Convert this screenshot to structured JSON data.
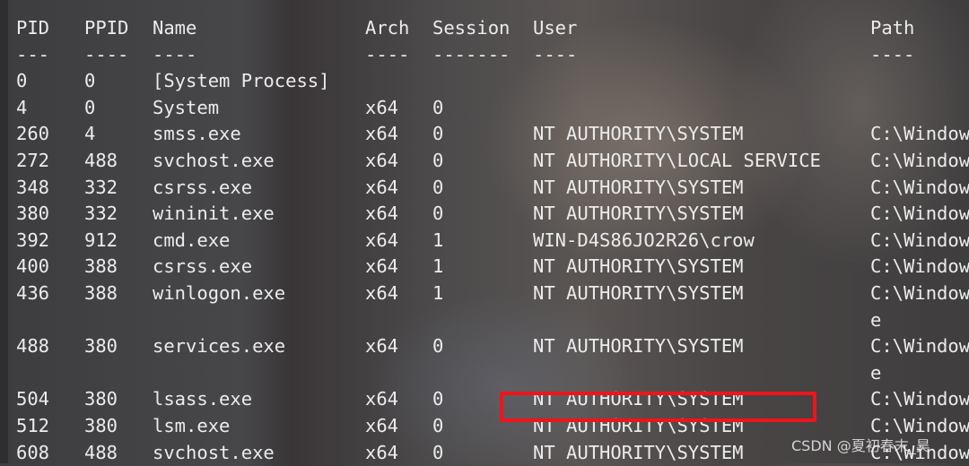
{
  "columns": [
    "PID",
    "PPID",
    "Name",
    "Arch",
    "Session",
    "User",
    "Path"
  ],
  "separators": [
    "---",
    "----",
    "----",
    "----",
    "-------",
    "----",
    "----"
  ],
  "rows": [
    [
      "0",
      "0",
      "[System Process]",
      "",
      "",
      "",
      ""
    ],
    [
      "4",
      "0",
      "System",
      "x64",
      "0",
      "",
      ""
    ],
    [
      "260",
      "4",
      "smss.exe",
      "x64",
      "0",
      "NT AUTHORITY\\SYSTEM",
      "C:\\Window"
    ],
    [
      "272",
      "488",
      "svchost.exe",
      "x64",
      "0",
      "NT AUTHORITY\\LOCAL SERVICE",
      "C:\\Window"
    ],
    [
      "348",
      "332",
      "csrss.exe",
      "x64",
      "0",
      "NT AUTHORITY\\SYSTEM",
      "C:\\Window"
    ],
    [
      "380",
      "332",
      "wininit.exe",
      "x64",
      "0",
      "NT AUTHORITY\\SYSTEM",
      "C:\\Window"
    ],
    [
      "392",
      "912",
      "cmd.exe",
      "x64",
      "1",
      "WIN-D4S86JO2R26\\crow",
      "C:\\Window"
    ],
    [
      "400",
      "388",
      "csrss.exe",
      "x64",
      "1",
      "NT AUTHORITY\\SYSTEM",
      "C:\\Window"
    ],
    [
      "436",
      "388",
      "winlogon.exe",
      "x64",
      "1",
      "NT AUTHORITY\\SYSTEM",
      "C:\\Window"
    ],
    [
      "",
      "",
      "",
      "",
      "",
      "",
      "e"
    ],
    [
      "488",
      "380",
      "services.exe",
      "x64",
      "0",
      "NT AUTHORITY\\SYSTEM",
      "C:\\Window"
    ],
    [
      "",
      "",
      "",
      "",
      "",
      "",
      "e"
    ],
    [
      "504",
      "380",
      "lsass.exe",
      "x64",
      "0",
      "NT AUTHORITY\\SYSTEM",
      "C:\\Window"
    ],
    [
      "512",
      "380",
      "lsm.exe",
      "x64",
      "0",
      "NT AUTHORITY\\SYSTEM",
      "C:\\Window"
    ],
    [
      "608",
      "488",
      "svchost.exe",
      "x64",
      "0",
      "NT AUTHORITY\\SYSTEM",
      "C:\\Window"
    ]
  ],
  "highlight_color": "#f0141a",
  "watermark": "CSDN @夏初春末_昊"
}
